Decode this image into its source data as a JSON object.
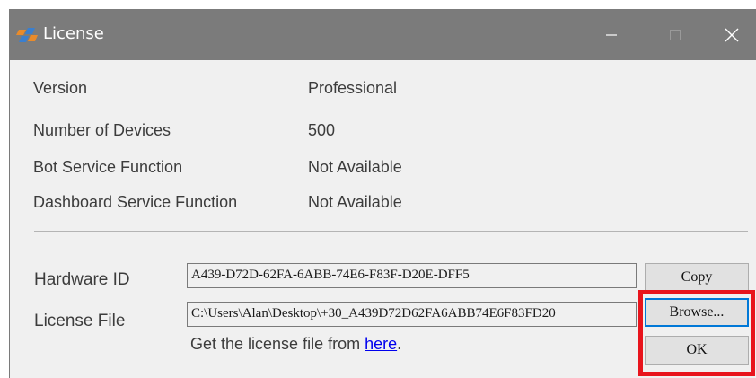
{
  "window": {
    "title": "License",
    "icon": "app-logo-icon",
    "controls": {
      "minimize_icon": "minimize-icon",
      "maximize_icon": "maximize-icon",
      "close_icon": "close-icon"
    },
    "titlebar_color": "#7b7b7b"
  },
  "info": {
    "rows": [
      {
        "label": "Version",
        "value": "Professional"
      },
      {
        "label": "Number of Devices",
        "value": "500"
      },
      {
        "label": "Bot Service Function",
        "value": "Not Available"
      },
      {
        "label": "Dashboard Service Function",
        "value": "Not Available"
      }
    ]
  },
  "hardware": {
    "label": "Hardware ID",
    "value": "A439-D72D-62FA-6ABB-74E6-F83F-D20E-DFF5",
    "copy_button": "Copy"
  },
  "license": {
    "label": "License File",
    "value": "C:\\Users\\Alan\\Desktop\\+30_A439D72D62FA6ABB74E6F83FD20",
    "browse_button": "Browse...",
    "ok_button": "OK",
    "hint_prefix": "Get the license file from ",
    "hint_link": "here",
    "hint_suffix": "."
  },
  "annotation": {
    "highlight_color": "#e8141c"
  }
}
